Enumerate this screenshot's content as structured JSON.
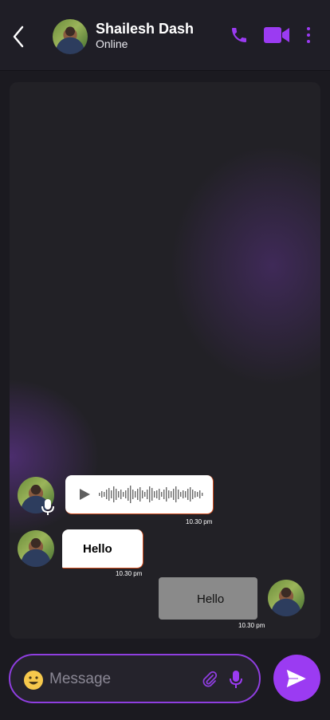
{
  "header": {
    "contact_name": "Shailesh Dash",
    "contact_status": "Online",
    "icons": [
      "back-icon",
      "phone-icon",
      "video-camera-icon",
      "more-vertical-icon"
    ]
  },
  "colors": {
    "accent": "#9b3bf2",
    "background": "#1b1a20",
    "bubble_incoming": "#ffffff",
    "bubble_outgoing": "#8a8a8a"
  },
  "messages": [
    {
      "type": "voice",
      "direction": "incoming",
      "time": "10.30 pm"
    },
    {
      "type": "text",
      "direction": "incoming",
      "text": "Hello",
      "time": "10.30 pm"
    },
    {
      "type": "text",
      "direction": "outgoing",
      "text": "Hello",
      "time": "10.30 pm"
    }
  ],
  "composer": {
    "placeholder": "Message",
    "value": "",
    "icons": [
      "emoji-icon",
      "attachment-icon",
      "microphone-icon",
      "send-icon"
    ]
  }
}
